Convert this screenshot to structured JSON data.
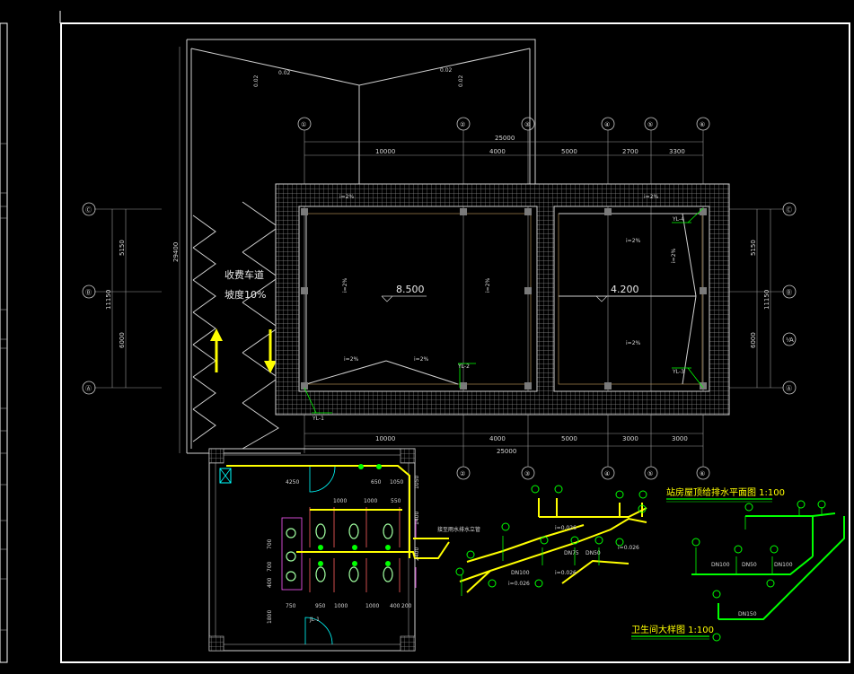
{
  "top_plan": {
    "axes_numbers": [
      "①",
      "②",
      "③",
      "④",
      "⑤",
      "⑥"
    ],
    "axes_letters": [
      "Ⓒ",
      "Ⓑ",
      "Ⓐ",
      "Ⓐ"
    ],
    "axis_right_extra": "⅟A",
    "dims_top": [
      "10000",
      "4000",
      "5000",
      "2700",
      "3300"
    ],
    "dim_total_top": "25000",
    "dims_bottom": [
      "10000",
      "4000",
      "5000",
      "3000",
      "3000"
    ],
    "dim_total_bottom": "25000",
    "dims_left": [
      "5150",
      "6000"
    ],
    "dim_left_total": "11150",
    "dim_overall_left": "29400",
    "dims_right": [
      "5150",
      "6000"
    ],
    "dim_right_total": "11150",
    "elev_left": "8.500",
    "elev_right": "4.200",
    "ramp_line1": "收费车道",
    "ramp_line2": "坡度10%",
    "tags": [
      "YL-1",
      "YL-2",
      "YL-3",
      "YL-4"
    ],
    "slope_labels": [
      "0.02",
      "0.02",
      "0.02",
      "0.02"
    ],
    "slope_small": [
      "i=2%",
      "i=2%",
      "i=2%",
      "i=2%",
      "i=2%",
      "i=2%",
      "i=2%",
      "i=2%",
      "i=2%",
      "i=2%",
      "i=2%",
      "i=2%"
    ]
  },
  "toilet_plan": {
    "dims_top": [
      "4250",
      "650",
      "1050"
    ],
    "dims_mid": [
      "1000",
      "1000",
      "550"
    ],
    "dims_bottom": [
      "750",
      "950",
      "1000",
      "1000",
      "400",
      "200"
    ],
    "dims_left": [
      "700",
      "700",
      "400",
      "1800"
    ],
    "dims_right": [
      "1050",
      "1400",
      "2400"
    ],
    "door_tag": "JL-1",
    "note": "接至雨水排水立管"
  },
  "title_roof": "站房屋顶给排水平面图  1:100",
  "title_toilet": "卫生间大样图  1:100",
  "iso_labels": [
    "i=0.026",
    "i=0.026",
    "i=0.026",
    "i=0.026",
    "DN100",
    "DN75",
    "DN50",
    "DN100",
    "DN50",
    "DN100",
    "DN150"
  ],
  "colors": {
    "pipe": "#ffff00",
    "supply": "#00ff00",
    "frame": "#ffffff",
    "wall": "#d0d0d0"
  }
}
